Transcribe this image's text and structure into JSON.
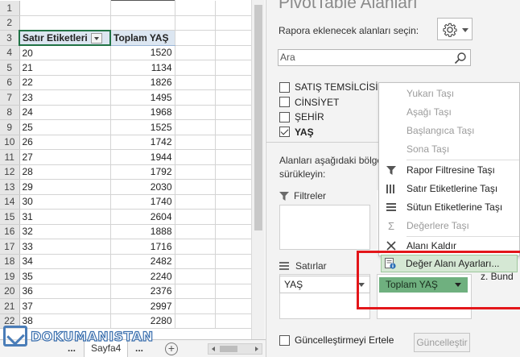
{
  "sheet": {
    "empty_rows": [
      "1",
      "2"
    ],
    "header_row": {
      "row": "3",
      "col_a": "Satır Etiketleri",
      "col_b": "Toplam YAŞ"
    },
    "rows": [
      {
        "row": "4",
        "label": "20",
        "value": "1520"
      },
      {
        "row": "5",
        "label": "21",
        "value": "1134"
      },
      {
        "row": "6",
        "label": "22",
        "value": "1826"
      },
      {
        "row": "7",
        "label": "23",
        "value": "1495"
      },
      {
        "row": "8",
        "label": "24",
        "value": "1968"
      },
      {
        "row": "9",
        "label": "25",
        "value": "1525"
      },
      {
        "row": "10",
        "label": "26",
        "value": "1742"
      },
      {
        "row": "11",
        "label": "27",
        "value": "1944"
      },
      {
        "row": "12",
        "label": "28",
        "value": "1792"
      },
      {
        "row": "13",
        "label": "29",
        "value": "2030"
      },
      {
        "row": "14",
        "label": "30",
        "value": "1740"
      },
      {
        "row": "15",
        "label": "31",
        "value": "2604"
      },
      {
        "row": "16",
        "label": "32",
        "value": "1888"
      },
      {
        "row": "17",
        "label": "33",
        "value": "1716"
      },
      {
        "row": "18",
        "label": "34",
        "value": "2482"
      },
      {
        "row": "19",
        "label": "35",
        "value": "2240"
      },
      {
        "row": "20",
        "label": "36",
        "value": "2376"
      },
      {
        "row": "21",
        "label": "37",
        "value": "2997"
      },
      {
        "row": "22",
        "label": "38",
        "value": "2280"
      }
    ],
    "tabs": {
      "dots_left": "...",
      "sheet_name": "Sayfa4",
      "dots_right": "...",
      "add": "+"
    }
  },
  "watermark": {
    "text": "DOKUMANISTAN"
  },
  "panel": {
    "title": "PivotTable Alanları",
    "prompt": "Rapora eklenecek alanları seçin:",
    "search_placeholder": "Ara",
    "fields": [
      {
        "label": "SATIŞ TEMSİLCİSİ",
        "checked": false
      },
      {
        "label": "CİNSİYET",
        "checked": false
      },
      {
        "label": "ŞEHİR",
        "checked": false
      },
      {
        "label": "YAŞ",
        "checked": true
      }
    ],
    "drag_label": "Alanları aşağıdaki bölge sürükleyin:",
    "filters_label": "Filtreler",
    "rows_label": "Satırlar",
    "rows_field": "YAŞ",
    "values_field": "Toplam YAŞ",
    "defer_label": "Güncelleştirmeyi Ertele",
    "update_button": "Güncelleştir",
    "overflow_text": "z. Bund"
  },
  "context_menu": {
    "items": [
      {
        "label": "Yukarı Taşı",
        "icon": "none",
        "disabled": true
      },
      {
        "label": "Aşağı Taşı",
        "icon": "none",
        "disabled": true
      },
      {
        "label": "Başlangıca Taşı",
        "icon": "none",
        "disabled": true
      },
      {
        "label": "Sona Taşı",
        "icon": "none",
        "disabled": true
      },
      {
        "label": "Rapor Filtresine Taşı",
        "icon": "funnel-icon",
        "disabled": false
      },
      {
        "label": "Satır Etiketlerine Taşı",
        "icon": "rows-icon",
        "disabled": false
      },
      {
        "label": "Sütun Etiketlerine Taşı",
        "icon": "columns-icon",
        "disabled": false
      },
      {
        "label": "Değerlere Taşı",
        "icon": "sigma-icon",
        "disabled": true
      },
      {
        "label": "Alanı Kaldır",
        "icon": "x-icon",
        "disabled": false
      },
      {
        "label": "Değer Alanı Ayarları...",
        "icon": "field-settings-icon",
        "disabled": false,
        "active": true
      }
    ]
  },
  "colors": {
    "accent_green": "#217346",
    "header_fill": "#dce6f1",
    "values_chip": "#6fb07f",
    "highlight": "#e3161a"
  }
}
